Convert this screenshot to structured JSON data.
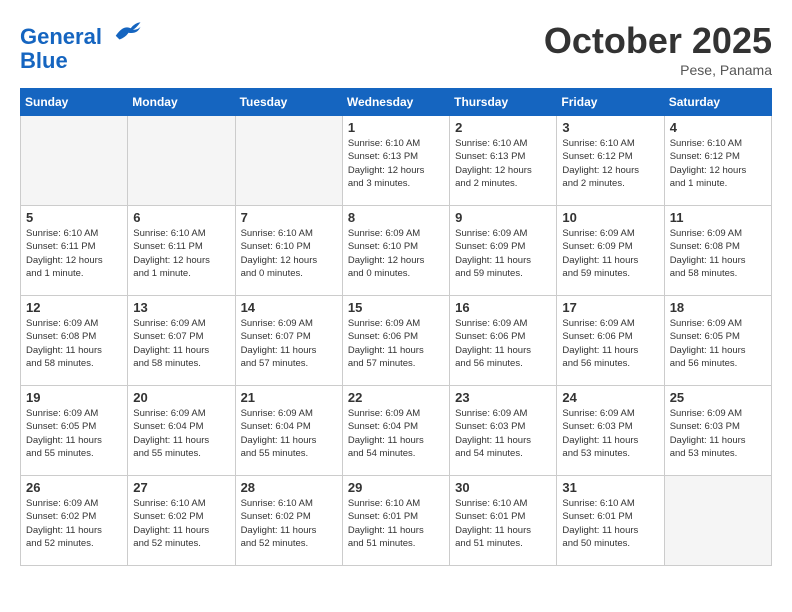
{
  "header": {
    "logo_line1": "General",
    "logo_line2": "Blue",
    "month": "October 2025",
    "location": "Pese, Panama"
  },
  "days_of_week": [
    "Sunday",
    "Monday",
    "Tuesday",
    "Wednesday",
    "Thursday",
    "Friday",
    "Saturday"
  ],
  "weeks": [
    [
      {
        "num": "",
        "info": ""
      },
      {
        "num": "",
        "info": ""
      },
      {
        "num": "",
        "info": ""
      },
      {
        "num": "1",
        "info": "Sunrise: 6:10 AM\nSunset: 6:13 PM\nDaylight: 12 hours\nand 3 minutes."
      },
      {
        "num": "2",
        "info": "Sunrise: 6:10 AM\nSunset: 6:13 PM\nDaylight: 12 hours\nand 2 minutes."
      },
      {
        "num": "3",
        "info": "Sunrise: 6:10 AM\nSunset: 6:12 PM\nDaylight: 12 hours\nand 2 minutes."
      },
      {
        "num": "4",
        "info": "Sunrise: 6:10 AM\nSunset: 6:12 PM\nDaylight: 12 hours\nand 1 minute."
      }
    ],
    [
      {
        "num": "5",
        "info": "Sunrise: 6:10 AM\nSunset: 6:11 PM\nDaylight: 12 hours\nand 1 minute."
      },
      {
        "num": "6",
        "info": "Sunrise: 6:10 AM\nSunset: 6:11 PM\nDaylight: 12 hours\nand 1 minute."
      },
      {
        "num": "7",
        "info": "Sunrise: 6:10 AM\nSunset: 6:10 PM\nDaylight: 12 hours\nand 0 minutes."
      },
      {
        "num": "8",
        "info": "Sunrise: 6:09 AM\nSunset: 6:10 PM\nDaylight: 12 hours\nand 0 minutes."
      },
      {
        "num": "9",
        "info": "Sunrise: 6:09 AM\nSunset: 6:09 PM\nDaylight: 11 hours\nand 59 minutes."
      },
      {
        "num": "10",
        "info": "Sunrise: 6:09 AM\nSunset: 6:09 PM\nDaylight: 11 hours\nand 59 minutes."
      },
      {
        "num": "11",
        "info": "Sunrise: 6:09 AM\nSunset: 6:08 PM\nDaylight: 11 hours\nand 58 minutes."
      }
    ],
    [
      {
        "num": "12",
        "info": "Sunrise: 6:09 AM\nSunset: 6:08 PM\nDaylight: 11 hours\nand 58 minutes."
      },
      {
        "num": "13",
        "info": "Sunrise: 6:09 AM\nSunset: 6:07 PM\nDaylight: 11 hours\nand 58 minutes."
      },
      {
        "num": "14",
        "info": "Sunrise: 6:09 AM\nSunset: 6:07 PM\nDaylight: 11 hours\nand 57 minutes."
      },
      {
        "num": "15",
        "info": "Sunrise: 6:09 AM\nSunset: 6:06 PM\nDaylight: 11 hours\nand 57 minutes."
      },
      {
        "num": "16",
        "info": "Sunrise: 6:09 AM\nSunset: 6:06 PM\nDaylight: 11 hours\nand 56 minutes."
      },
      {
        "num": "17",
        "info": "Sunrise: 6:09 AM\nSunset: 6:06 PM\nDaylight: 11 hours\nand 56 minutes."
      },
      {
        "num": "18",
        "info": "Sunrise: 6:09 AM\nSunset: 6:05 PM\nDaylight: 11 hours\nand 56 minutes."
      }
    ],
    [
      {
        "num": "19",
        "info": "Sunrise: 6:09 AM\nSunset: 6:05 PM\nDaylight: 11 hours\nand 55 minutes."
      },
      {
        "num": "20",
        "info": "Sunrise: 6:09 AM\nSunset: 6:04 PM\nDaylight: 11 hours\nand 55 minutes."
      },
      {
        "num": "21",
        "info": "Sunrise: 6:09 AM\nSunset: 6:04 PM\nDaylight: 11 hours\nand 55 minutes."
      },
      {
        "num": "22",
        "info": "Sunrise: 6:09 AM\nSunset: 6:04 PM\nDaylight: 11 hours\nand 54 minutes."
      },
      {
        "num": "23",
        "info": "Sunrise: 6:09 AM\nSunset: 6:03 PM\nDaylight: 11 hours\nand 54 minutes."
      },
      {
        "num": "24",
        "info": "Sunrise: 6:09 AM\nSunset: 6:03 PM\nDaylight: 11 hours\nand 53 minutes."
      },
      {
        "num": "25",
        "info": "Sunrise: 6:09 AM\nSunset: 6:03 PM\nDaylight: 11 hours\nand 53 minutes."
      }
    ],
    [
      {
        "num": "26",
        "info": "Sunrise: 6:09 AM\nSunset: 6:02 PM\nDaylight: 11 hours\nand 52 minutes."
      },
      {
        "num": "27",
        "info": "Sunrise: 6:10 AM\nSunset: 6:02 PM\nDaylight: 11 hours\nand 52 minutes."
      },
      {
        "num": "28",
        "info": "Sunrise: 6:10 AM\nSunset: 6:02 PM\nDaylight: 11 hours\nand 52 minutes."
      },
      {
        "num": "29",
        "info": "Sunrise: 6:10 AM\nSunset: 6:01 PM\nDaylight: 11 hours\nand 51 minutes."
      },
      {
        "num": "30",
        "info": "Sunrise: 6:10 AM\nSunset: 6:01 PM\nDaylight: 11 hours\nand 51 minutes."
      },
      {
        "num": "31",
        "info": "Sunrise: 6:10 AM\nSunset: 6:01 PM\nDaylight: 11 hours\nand 50 minutes."
      },
      {
        "num": "",
        "info": ""
      }
    ]
  ]
}
